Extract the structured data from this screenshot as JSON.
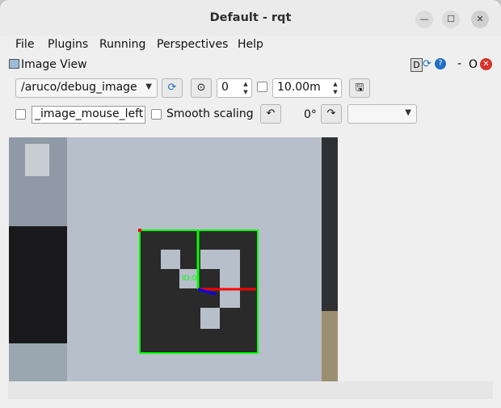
{
  "window": {
    "title": "Default - rqt",
    "minimize_glyph": "—",
    "maximize_glyph": "☐",
    "close_glyph": "✕"
  },
  "menubar": {
    "items": [
      "File",
      "Plugins",
      "Running",
      "Perspectives",
      "Help"
    ]
  },
  "dock": {
    "title": "Image View",
    "right_label": "D",
    "minus_label": "-",
    "o_label": "O"
  },
  "toolbar": {
    "topic": "/aruco/debug_image",
    "refresh_icon": "refresh-icon",
    "zoom_icon": "zoom-fit-icon",
    "spin_value": "0",
    "timeout_value": "10.00m",
    "save_icon": "save-icon"
  },
  "row2": {
    "mouse_topic": "_image_mouse_left",
    "smooth_label": "Smooth scaling",
    "rotation": "0°",
    "rotate_left_icon": "rotate-left-icon",
    "rotate_right_icon": "rotate-right-icon",
    "combo_value": ""
  },
  "image": {
    "marker_label": "ID:0",
    "colors": {
      "axis_x": "#ff0000",
      "axis_y": "#00ff00",
      "axis_z": "#0000ff",
      "border": "#00ff00",
      "marker": "#2a2a2a"
    }
  }
}
